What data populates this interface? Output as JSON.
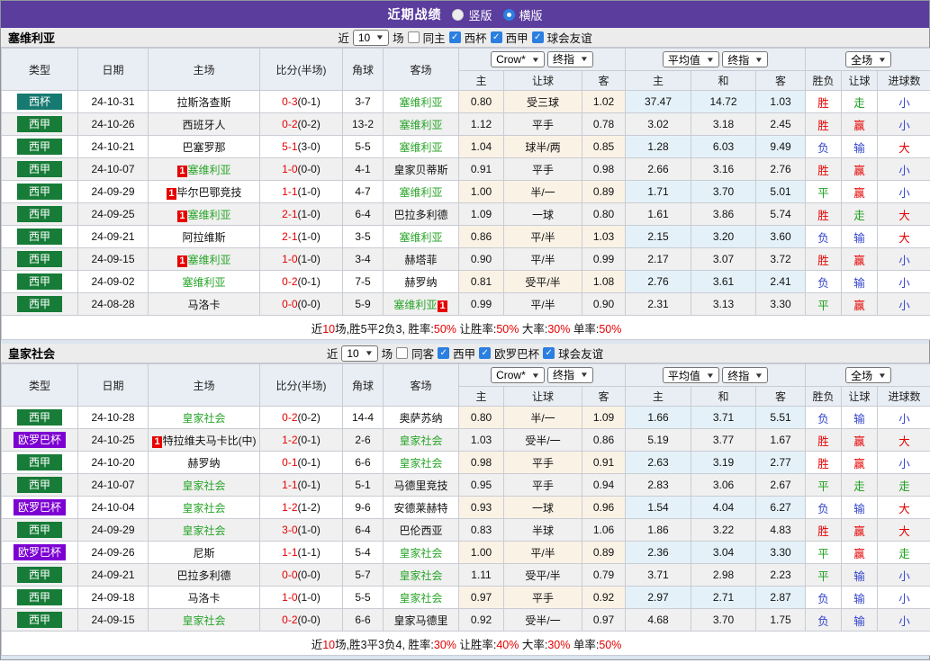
{
  "header": {
    "title": "近期战绩",
    "radio_vertical": "竖版",
    "radio_horizontal": "横版"
  },
  "columns": {
    "type": "类型",
    "date": "日期",
    "home": "主场",
    "score": "比分(半场)",
    "corner": "角球",
    "away": "客场",
    "odd_home": "主",
    "handicap": "让球",
    "odd_away": "客",
    "avg_home": "主",
    "avg_draw": "和",
    "avg_away": "客",
    "wdl": "胜负",
    "handicap_result": "让球",
    "goals": "进球数"
  },
  "colors": {
    "accent": "#5b3d9e",
    "score_red": "#e60000",
    "team_green": "#28a428",
    "res_red": "#e60000",
    "res_green": "#1a9e1a",
    "res_blue": "#3344cc",
    "handicap_bg": "#fbf2e6",
    "avg_bg": "#e4f1f8",
    "checkbox_blue": "#2b7fe0"
  },
  "badge_colors": {
    "西杯": "#177a70",
    "西甲": "#177c38",
    "欧罗巴杯": "#7c00d2"
  },
  "sections": [
    {
      "team": "塞维利亚",
      "filter": {
        "near": "近",
        "count": "10",
        "games": "场",
        "same": "同主",
        "leagues": [
          "西杯",
          "西甲",
          "球会友谊"
        ]
      },
      "selects": {
        "book": "Crow*",
        "book_stage": "终指",
        "avg": "平均值",
        "avg_stage": "终指",
        "scope": "全场"
      },
      "rows": [
        {
          "type": "西杯",
          "date": "24-10-31",
          "home": {
            "name": "拉斯洛查斯"
          },
          "score": {
            "ft": "0-3",
            "ht": "(0-1)"
          },
          "corner": "3-7",
          "away": {
            "name": "塞维利亚",
            "green": true
          },
          "odds": [
            "0.80",
            "受三球",
            "1.02",
            "37.47",
            "14.72",
            "1.03"
          ],
          "results": [
            [
              "胜",
              "r"
            ],
            [
              "走",
              "g"
            ],
            [
              "小",
              "b"
            ]
          ]
        },
        {
          "type": "西甲",
          "date": "24-10-26",
          "home": {
            "name": "西班牙人"
          },
          "score": {
            "ft": "0-2",
            "ht": "(0-2)"
          },
          "corner": "13-2",
          "away": {
            "name": "塞维利亚",
            "green": true
          },
          "odds": [
            "1.12",
            "平手",
            "0.78",
            "3.02",
            "3.18",
            "2.45"
          ],
          "results": [
            [
              "胜",
              "r"
            ],
            [
              "赢",
              "r"
            ],
            [
              "小",
              "b"
            ]
          ]
        },
        {
          "type": "西甲",
          "date": "24-10-21",
          "home": {
            "name": "巴塞罗那"
          },
          "score": {
            "ft": "5-1",
            "ht": "(3-0)"
          },
          "corner": "5-5",
          "away": {
            "name": "塞维利亚",
            "green": true
          },
          "odds": [
            "1.04",
            "球半/两",
            "0.85",
            "1.28",
            "6.03",
            "9.49"
          ],
          "results": [
            [
              "负",
              "b"
            ],
            [
              "输",
              "b"
            ],
            [
              "大",
              "r"
            ]
          ]
        },
        {
          "type": "西甲",
          "date": "24-10-07",
          "home": {
            "name": "塞维利亚",
            "green": true,
            "badge": "1",
            "badge_pos": "before"
          },
          "score": {
            "ft": "1-0",
            "ht": "(0-0)"
          },
          "corner": "4-1",
          "away": {
            "name": "皇家贝蒂斯"
          },
          "odds": [
            "0.91",
            "平手",
            "0.98",
            "2.66",
            "3.16",
            "2.76"
          ],
          "results": [
            [
              "胜",
              "r"
            ],
            [
              "赢",
              "r"
            ],
            [
              "小",
              "b"
            ]
          ]
        },
        {
          "type": "西甲",
          "date": "24-09-29",
          "home": {
            "name": "毕尔巴鄂竞技",
            "badge": "1",
            "badge_pos": "before"
          },
          "score": {
            "ft": "1-1",
            "ht": "(1-0)"
          },
          "corner": "4-7",
          "away": {
            "name": "塞维利亚",
            "green": true
          },
          "odds": [
            "1.00",
            "半/一",
            "0.89",
            "1.71",
            "3.70",
            "5.01"
          ],
          "results": [
            [
              "平",
              "g"
            ],
            [
              "赢",
              "r"
            ],
            [
              "小",
              "b"
            ]
          ]
        },
        {
          "type": "西甲",
          "date": "24-09-25",
          "home": {
            "name": "塞维利亚",
            "green": true,
            "badge": "1",
            "badge_pos": "before"
          },
          "score": {
            "ft": "2-1",
            "ht": "(1-0)"
          },
          "corner": "6-4",
          "away": {
            "name": "巴拉多利德"
          },
          "odds": [
            "1.09",
            "一球",
            "0.80",
            "1.61",
            "3.86",
            "5.74"
          ],
          "results": [
            [
              "胜",
              "r"
            ],
            [
              "走",
              "g"
            ],
            [
              "大",
              "r"
            ]
          ]
        },
        {
          "type": "西甲",
          "date": "24-09-21",
          "home": {
            "name": "阿拉维斯"
          },
          "score": {
            "ft": "2-1",
            "ht": "(1-0)"
          },
          "corner": "3-5",
          "away": {
            "name": "塞维利亚",
            "green": true
          },
          "odds": [
            "0.86",
            "平/半",
            "1.03",
            "2.15",
            "3.20",
            "3.60"
          ],
          "results": [
            [
              "负",
              "b"
            ],
            [
              "输",
              "b"
            ],
            [
              "大",
              "r"
            ]
          ]
        },
        {
          "type": "西甲",
          "date": "24-09-15",
          "home": {
            "name": "塞维利亚",
            "green": true,
            "badge": "1",
            "badge_pos": "before"
          },
          "score": {
            "ft": "1-0",
            "ht": "(1-0)"
          },
          "corner": "3-4",
          "away": {
            "name": "赫塔菲"
          },
          "odds": [
            "0.90",
            "平/半",
            "0.99",
            "2.17",
            "3.07",
            "3.72"
          ],
          "results": [
            [
              "胜",
              "r"
            ],
            [
              "赢",
              "r"
            ],
            [
              "小",
              "b"
            ]
          ]
        },
        {
          "type": "西甲",
          "date": "24-09-02",
          "home": {
            "name": "塞维利亚",
            "green": true
          },
          "score": {
            "ft": "0-2",
            "ht": "(0-1)"
          },
          "corner": "7-5",
          "away": {
            "name": "赫罗纳"
          },
          "odds": [
            "0.81",
            "受平/半",
            "1.08",
            "2.76",
            "3.61",
            "2.41"
          ],
          "results": [
            [
              "负",
              "b"
            ],
            [
              "输",
              "b"
            ],
            [
              "小",
              "b"
            ]
          ]
        },
        {
          "type": "西甲",
          "date": "24-08-28",
          "home": {
            "name": "马洛卡"
          },
          "score": {
            "ft": "0-0",
            "ht": "(0-0)"
          },
          "corner": "5-9",
          "away": {
            "name": "塞维利亚",
            "green": true,
            "badge": "1",
            "badge_pos": "after"
          },
          "odds": [
            "0.99",
            "平/半",
            "0.90",
            "2.31",
            "3.13",
            "3.30"
          ],
          "results": [
            [
              "平",
              "g"
            ],
            [
              "赢",
              "r"
            ],
            [
              "小",
              "b"
            ]
          ]
        }
      ],
      "summary": [
        {
          "t": "近"
        },
        {
          "t": "10",
          "red": true
        },
        {
          "t": "场,胜5平2负3, 胜率:"
        },
        {
          "t": "50%",
          "red": true
        },
        {
          "t": " 让胜率:"
        },
        {
          "t": "50%",
          "red": true
        },
        {
          "t": " 大率:"
        },
        {
          "t": "30%",
          "red": true
        },
        {
          "t": " 单率:"
        },
        {
          "t": "50%",
          "red": true
        }
      ]
    },
    {
      "team": "皇家社会",
      "filter": {
        "near": "近",
        "count": "10",
        "games": "场",
        "same": "同客",
        "leagues": [
          "西甲",
          "欧罗巴杯",
          "球会友谊"
        ]
      },
      "selects": {
        "book": "Crow*",
        "book_stage": "终指",
        "avg": "平均值",
        "avg_stage": "终指",
        "scope": "全场"
      },
      "rows": [
        {
          "type": "西甲",
          "date": "24-10-28",
          "home": {
            "name": "皇家社会",
            "green": true
          },
          "score": {
            "ft": "0-2",
            "ht": "(0-2)"
          },
          "corner": "14-4",
          "away": {
            "name": "奥萨苏纳"
          },
          "odds": [
            "0.80",
            "半/一",
            "1.09",
            "1.66",
            "3.71",
            "5.51"
          ],
          "results": [
            [
              "负",
              "b"
            ],
            [
              "输",
              "b"
            ],
            [
              "小",
              "b"
            ]
          ]
        },
        {
          "type": "欧罗巴杯",
          "date": "24-10-25",
          "home": {
            "name": "特拉维夫马卡比(中)",
            "badge": "1",
            "badge_pos": "before"
          },
          "score": {
            "ft": "1-2",
            "ht": "(0-1)"
          },
          "corner": "2-6",
          "away": {
            "name": "皇家社会",
            "green": true
          },
          "odds": [
            "1.03",
            "受半/一",
            "0.86",
            "5.19",
            "3.77",
            "1.67"
          ],
          "results": [
            [
              "胜",
              "r"
            ],
            [
              "赢",
              "r"
            ],
            [
              "大",
              "r"
            ]
          ]
        },
        {
          "type": "西甲",
          "date": "24-10-20",
          "home": {
            "name": "赫罗纳"
          },
          "score": {
            "ft": "0-1",
            "ht": "(0-1)"
          },
          "corner": "6-6",
          "away": {
            "name": "皇家社会",
            "green": true
          },
          "odds": [
            "0.98",
            "平手",
            "0.91",
            "2.63",
            "3.19",
            "2.77"
          ],
          "results": [
            [
              "胜",
              "r"
            ],
            [
              "赢",
              "r"
            ],
            [
              "小",
              "b"
            ]
          ]
        },
        {
          "type": "西甲",
          "date": "24-10-07",
          "home": {
            "name": "皇家社会",
            "green": true
          },
          "score": {
            "ft": "1-1",
            "ht": "(0-1)"
          },
          "corner": "5-1",
          "away": {
            "name": "马德里竞技"
          },
          "odds": [
            "0.95",
            "平手",
            "0.94",
            "2.83",
            "3.06",
            "2.67"
          ],
          "results": [
            [
              "平",
              "g"
            ],
            [
              "走",
              "g"
            ],
            [
              "走",
              "g"
            ]
          ]
        },
        {
          "type": "欧罗巴杯",
          "date": "24-10-04",
          "home": {
            "name": "皇家社会",
            "green": true
          },
          "score": {
            "ft": "1-2",
            "ht": "(1-2)"
          },
          "corner": "9-6",
          "away": {
            "name": "安德莱赫特"
          },
          "odds": [
            "0.93",
            "一球",
            "0.96",
            "1.54",
            "4.04",
            "6.27"
          ],
          "results": [
            [
              "负",
              "b"
            ],
            [
              "输",
              "b"
            ],
            [
              "大",
              "r"
            ]
          ]
        },
        {
          "type": "西甲",
          "date": "24-09-29",
          "home": {
            "name": "皇家社会",
            "green": true
          },
          "score": {
            "ft": "3-0",
            "ht": "(1-0)"
          },
          "corner": "6-4",
          "away": {
            "name": "巴伦西亚"
          },
          "odds": [
            "0.83",
            "半球",
            "1.06",
            "1.86",
            "3.22",
            "4.83"
          ],
          "results": [
            [
              "胜",
              "r"
            ],
            [
              "赢",
              "r"
            ],
            [
              "大",
              "r"
            ]
          ]
        },
        {
          "type": "欧罗巴杯",
          "date": "24-09-26",
          "home": {
            "name": "尼斯"
          },
          "score": {
            "ft": "1-1",
            "ht": "(1-1)"
          },
          "corner": "5-4",
          "away": {
            "name": "皇家社会",
            "green": true
          },
          "odds": [
            "1.00",
            "平/半",
            "0.89",
            "2.36",
            "3.04",
            "3.30"
          ],
          "results": [
            [
              "平",
              "g"
            ],
            [
              "赢",
              "r"
            ],
            [
              "走",
              "g"
            ]
          ]
        },
        {
          "type": "西甲",
          "date": "24-09-21",
          "home": {
            "name": "巴拉多利德"
          },
          "score": {
            "ft": "0-0",
            "ht": "(0-0)"
          },
          "corner": "5-7",
          "away": {
            "name": "皇家社会",
            "green": true
          },
          "odds": [
            "1.11",
            "受平/半",
            "0.79",
            "3.71",
            "2.98",
            "2.23"
          ],
          "results": [
            [
              "平",
              "g"
            ],
            [
              "输",
              "b"
            ],
            [
              "小",
              "b"
            ]
          ]
        },
        {
          "type": "西甲",
          "date": "24-09-18",
          "home": {
            "name": "马洛卡"
          },
          "score": {
            "ft": "1-0",
            "ht": "(1-0)"
          },
          "corner": "5-5",
          "away": {
            "name": "皇家社会",
            "green": true
          },
          "odds": [
            "0.97",
            "平手",
            "0.92",
            "2.97",
            "2.71",
            "2.87"
          ],
          "results": [
            [
              "负",
              "b"
            ],
            [
              "输",
              "b"
            ],
            [
              "小",
              "b"
            ]
          ]
        },
        {
          "type": "西甲",
          "date": "24-09-15",
          "home": {
            "name": "皇家社会",
            "green": true
          },
          "score": {
            "ft": "0-2",
            "ht": "(0-0)"
          },
          "corner": "6-6",
          "away": {
            "name": "皇家马德里"
          },
          "odds": [
            "0.92",
            "受半/一",
            "0.97",
            "4.68",
            "3.70",
            "1.75"
          ],
          "results": [
            [
              "负",
              "b"
            ],
            [
              "输",
              "b"
            ],
            [
              "小",
              "b"
            ]
          ]
        }
      ],
      "summary": [
        {
          "t": "近"
        },
        {
          "t": "10",
          "red": true
        },
        {
          "t": "场,胜3平3负4, 胜率:"
        },
        {
          "t": "30%",
          "red": true
        },
        {
          "t": " 让胜率:"
        },
        {
          "t": "40%",
          "red": true
        },
        {
          "t": " 大率:"
        },
        {
          "t": "30%",
          "red": true
        },
        {
          "t": " 单率:"
        },
        {
          "t": "50%",
          "red": true
        }
      ]
    }
  ]
}
